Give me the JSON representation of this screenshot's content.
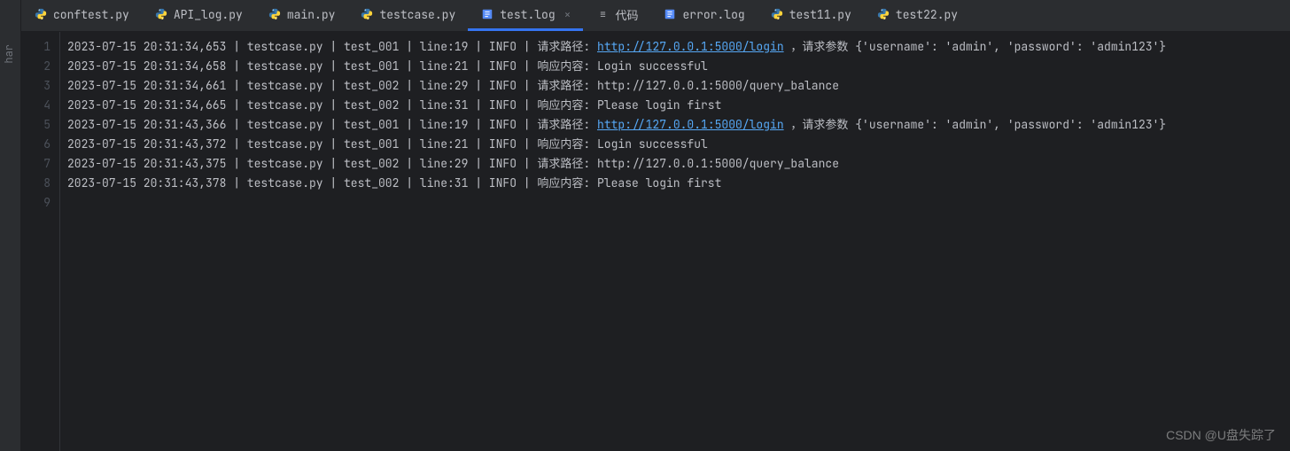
{
  "sidebar": {
    "label": "har"
  },
  "tabs": [
    {
      "icon": "python",
      "label": "conftest.py",
      "active": false
    },
    {
      "icon": "python",
      "label": "API_log.py",
      "active": false
    },
    {
      "icon": "python",
      "label": "main.py",
      "active": false
    },
    {
      "icon": "python",
      "label": "testcase.py",
      "active": false
    },
    {
      "icon": "log",
      "label": "test.log",
      "active": true,
      "closable": true
    },
    {
      "icon": "text",
      "label": "代码",
      "active": false
    },
    {
      "icon": "log",
      "label": "error.log",
      "active": false
    },
    {
      "icon": "python",
      "label": "test11.py",
      "active": false
    },
    {
      "icon": "python",
      "label": "test22.py",
      "active": false
    }
  ],
  "lines": [
    {
      "n": 1,
      "pre": "2023-07-15 20:31:34,653 | testcase.py | test_001 | line:19 | INFO | 请求路径: ",
      "url": "http://127.0.0.1:5000/login",
      "post": " ，请求参数 {'username': 'admin', 'password': 'admin123'}"
    },
    {
      "n": 2,
      "pre": "2023-07-15 20:31:34,658 | testcase.py | test_001 | line:21 | INFO | 响应内容: Login successful",
      "url": "",
      "post": ""
    },
    {
      "n": 3,
      "pre": "2023-07-15 20:31:34,661 | testcase.py | test_002 | line:29 | INFO | 请求路径: http://127.0.0.1:5000/query_balance",
      "url": "",
      "post": ""
    },
    {
      "n": 4,
      "pre": "2023-07-15 20:31:34,665 | testcase.py | test_002 | line:31 | INFO | 响应内容: Please login first",
      "url": "",
      "post": ""
    },
    {
      "n": 5,
      "pre": "2023-07-15 20:31:43,366 | testcase.py | test_001 | line:19 | INFO | 请求路径: ",
      "url": "http://127.0.0.1:5000/login",
      "post": " ，请求参数 {'username': 'admin', 'password': 'admin123'}"
    },
    {
      "n": 6,
      "pre": "2023-07-15 20:31:43,372 | testcase.py | test_001 | line:21 | INFO | 响应内容: Login successful",
      "url": "",
      "post": ""
    },
    {
      "n": 7,
      "pre": "2023-07-15 20:31:43,375 | testcase.py | test_002 | line:29 | INFO | 请求路径: http://127.0.0.1:5000/query_balance",
      "url": "",
      "post": ""
    },
    {
      "n": 8,
      "pre": "2023-07-15 20:31:43,378 | testcase.py | test_002 | line:31 | INFO | 响应内容: Please login first",
      "url": "",
      "post": ""
    },
    {
      "n": 9,
      "pre": "",
      "url": "",
      "post": ""
    }
  ],
  "watermark": "CSDN @U盘失踪了",
  "close_glyph": "×"
}
